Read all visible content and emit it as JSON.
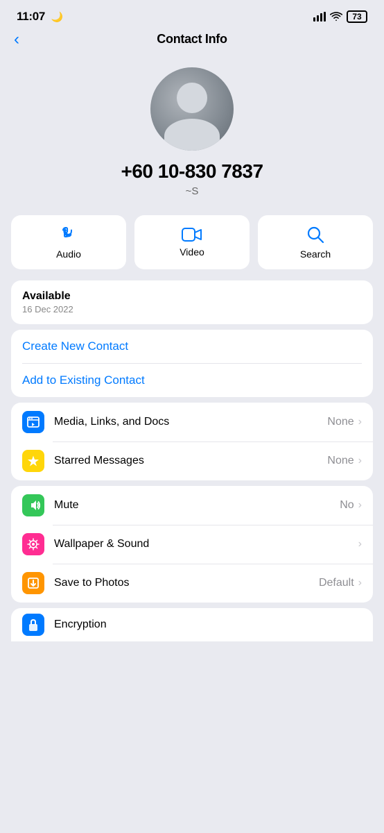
{
  "statusBar": {
    "time": "11:07",
    "moonIcon": "🌙",
    "battery": "73"
  },
  "navBar": {
    "backIcon": "‹",
    "title": "Contact Info"
  },
  "contact": {
    "number": "+60 10-830 7837",
    "alias": "~S"
  },
  "actions": [
    {
      "id": "audio",
      "label": "Audio"
    },
    {
      "id": "video",
      "label": "Video"
    },
    {
      "id": "search",
      "label": "Search"
    }
  ],
  "availabilityCard": {
    "status": "Available",
    "date": "16 Dec 2022"
  },
  "links": [
    {
      "id": "create-new-contact",
      "label": "Create New Contact"
    },
    {
      "id": "add-existing-contact",
      "label": "Add to Existing Contact"
    }
  ],
  "listItems": [
    {
      "id": "media-links-docs",
      "iconColor": "blue",
      "label": "Media, Links, and Docs",
      "value": "None",
      "hasChevron": true
    },
    {
      "id": "starred-messages",
      "iconColor": "yellow",
      "label": "Starred Messages",
      "value": "None",
      "hasChevron": true
    }
  ],
  "settingsItems": [
    {
      "id": "mute",
      "iconColor": "green",
      "label": "Mute",
      "value": "No",
      "hasChevron": true
    },
    {
      "id": "wallpaper-sound",
      "iconColor": "pink",
      "label": "Wallpaper & Sound",
      "value": "",
      "hasChevron": true
    },
    {
      "id": "save-to-photos",
      "iconColor": "orange-dl",
      "label": "Save to Photos",
      "value": "Default",
      "hasChevron": true
    }
  ],
  "partialItem": {
    "id": "encryption",
    "label": "Encryption",
    "iconColor": "blue-enc"
  }
}
